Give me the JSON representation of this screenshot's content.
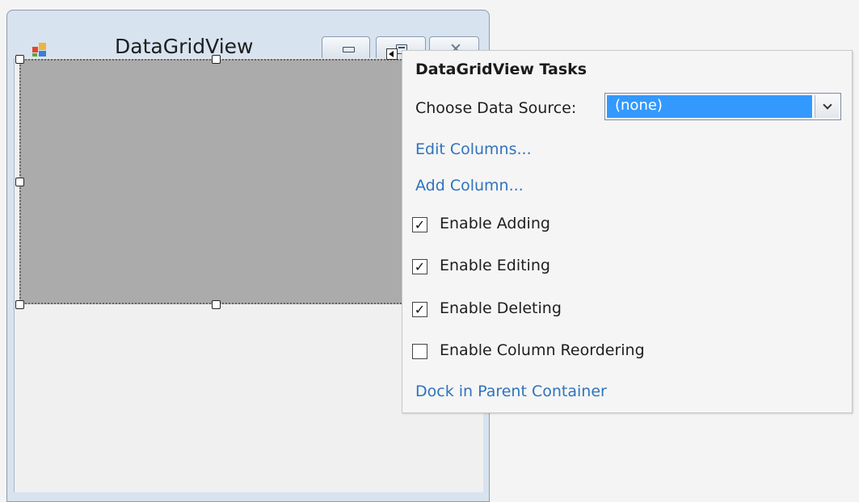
{
  "form": {
    "title": "DataGridView",
    "icon": "form-app-icon"
  },
  "tasks": {
    "title": "DataGridView Tasks",
    "data_source": {
      "label": "Choose Data Source:",
      "value": "(none)"
    },
    "links": {
      "edit_columns": "Edit Columns...",
      "add_column": "Add Column...",
      "dock": "Dock in Parent Container"
    },
    "checkboxes": [
      {
        "label": "Enable Adding",
        "checked": true,
        "mark": "✓"
      },
      {
        "label": "Enable Editing",
        "checked": true,
        "mark": "✓"
      },
      {
        "label": "Enable Deleting",
        "checked": true,
        "mark": "✓"
      },
      {
        "label": "Enable Column Reordering",
        "checked": false,
        "mark": ""
      }
    ]
  },
  "colors": {
    "link": "#2f73bd",
    "selection": "#3399ff",
    "grid_background": "#ababab"
  }
}
